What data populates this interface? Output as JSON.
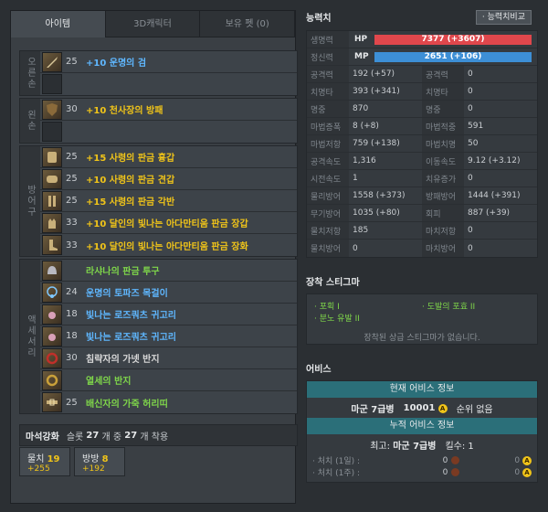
{
  "tabs": [
    {
      "label": "아이템"
    },
    {
      "label": "3D캐릭터"
    },
    {
      "label": "보유 펫 (0)"
    }
  ],
  "groups": {
    "right_hand": {
      "label": "오른손"
    },
    "left_hand": {
      "label": "왼손"
    },
    "armor": {
      "label": "방어구"
    },
    "accessory": {
      "label": "액세서리"
    }
  },
  "items": {
    "rh1": {
      "level": "25",
      "name": "+10 운명의 검"
    },
    "lh1": {
      "level": "30",
      "name": "+10 천사장의 방패"
    },
    "ar1": {
      "level": "25",
      "name": "+15 사령의 판금 흉갑"
    },
    "ar2": {
      "level": "25",
      "name": "+10 사령의 판금 견갑"
    },
    "ar3": {
      "level": "25",
      "name": "+15 사령의 판금 각반"
    },
    "ar4": {
      "level": "33",
      "name": "+10 달인의 빛나는 아다만티움 판금 장갑"
    },
    "ar5": {
      "level": "33",
      "name": "+10 달인의 빛나는 아다만티움 판금 장화"
    },
    "ac1": {
      "level": "",
      "name": "라샤나의 판금 투구"
    },
    "ac2": {
      "level": "24",
      "name": "운명의 토파즈 목걸이"
    },
    "ac3": {
      "level": "18",
      "name": "빛나는 로즈쿼츠 귀고리"
    },
    "ac4": {
      "level": "18",
      "name": "빛나는 로즈쿼츠 귀고리"
    },
    "ac5": {
      "level": "30",
      "name": "침략자의 가넷 반지"
    },
    "ac6": {
      "level": "",
      "name": "열세의 반지"
    },
    "ac7": {
      "level": "25",
      "name": "배신자의 가죽 허리띠"
    }
  },
  "manastone": {
    "title": "마석강화",
    "text_a": "슬롯",
    "text_b": "개 중",
    "text_c": "개 착용",
    "total": "27",
    "used": "27",
    "stones": [
      {
        "name": "물치",
        "count": "19",
        "bonus": "+255"
      },
      {
        "name": "방방",
        "count": "8",
        "bonus": "+192"
      }
    ]
  },
  "stats": {
    "title": "능력치",
    "compare_button": "· 능력치비교",
    "hp": {
      "label": "생명력",
      "key": "HP",
      "value": "7377 (+3607)"
    },
    "mp": {
      "label": "정신력",
      "key": "MP",
      "value": "2651 (+106)"
    },
    "rows": [
      {
        "l1": "공격력",
        "v1": "192 (+57)",
        "l2": "공격력",
        "v2": "0"
      },
      {
        "l1": "치명타",
        "v1": "393 (+341)",
        "l2": "치명타",
        "v2": "0"
      },
      {
        "l1": "명중",
        "v1": "870",
        "l2": "명중",
        "v2": "0"
      },
      {
        "l1": "마법증폭",
        "v1": "8 (+8)",
        "l2": "마법적중",
        "v2": "591"
      },
      {
        "l1": "마법저항",
        "v1": "759 (+138)",
        "l2": "마법치명",
        "v2": "50"
      },
      {
        "l1": "공격속도",
        "v1": "1,316",
        "l2": "이동속도",
        "v2": "9.12 (+3.12)"
      },
      {
        "l1": "시전속도",
        "v1": "1",
        "l2": "치유증가",
        "v2": "0"
      },
      {
        "l1": "물리방어",
        "v1": "1558 (+373)",
        "l2": "방패방어",
        "v2": "1444 (+391)"
      },
      {
        "l1": "무기방어",
        "v1": "1035 (+80)",
        "l2": "회피",
        "v2": "887 (+39)"
      },
      {
        "l1": "물치저항",
        "v1": "185",
        "l2": "마치저항",
        "v2": "0"
      },
      {
        "l1": "물치방어",
        "v1": "0",
        "l2": "마치방어",
        "v2": "0"
      }
    ]
  },
  "stigma": {
    "title": "장착 스티그마",
    "items": [
      "· 포획 I",
      "· 도발의 포효 II",
      "· 분노 유발 II"
    ],
    "note": "장착된 상급 스티그마가 없습니다."
  },
  "abyss": {
    "title": "어비스",
    "current_head": "현재 어비스 정보",
    "rank": "마군 7급병",
    "points": "10001",
    "place": "순위 없음",
    "cumulative_head": "누적 어비스 정보",
    "best_label": "최고:",
    "best_rank": "마군 7급병",
    "kills_label": "킬수: 1",
    "k1_label": "· 처치 (1일) :",
    "k1_a": "0",
    "k1_b": "0",
    "k2_label": "· 처치 (1주) :",
    "k2_a": "0",
    "k2_b": "0"
  },
  "colors": {
    "hp_bar": "#e0474c",
    "mp_bar": "#3d8fd6",
    "abyss_header": "#2b6f79"
  }
}
